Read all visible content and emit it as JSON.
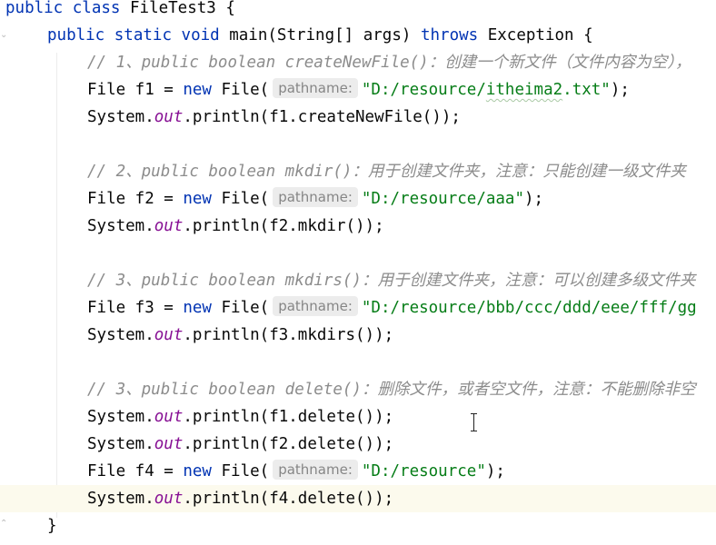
{
  "code": {
    "l0": {
      "kw1": "public",
      "kw2": "class",
      "name": "FileTest3 {"
    },
    "l1": {
      "kw1": "public",
      "kw2": "static",
      "kw3": "void",
      "sig": "main(String[] args)",
      "kw4": "throws",
      "rest": "Exception {"
    },
    "l2": {
      "comment": "// 1、public boolean createNewFile()：创建一个新文件（文件内容为空），"
    },
    "l3": {
      "a": "File f1 = ",
      "kw": "new",
      "b": " File(",
      "hint": "pathname:",
      "str_pre": "\"D:/resource/",
      "str_wavy": "itheima2",
      "str_post": ".txt\"",
      "c": ");"
    },
    "l4": {
      "a": "System.",
      "field": "out",
      "b": ".println(f1.createNewFile());"
    },
    "l6": {
      "comment": "// 2、public boolean mkdir()：用于创建文件夹，注意：只能创建一级文件夹"
    },
    "l7": {
      "a": "File f2 = ",
      "kw": "new",
      "b": " File(",
      "hint": "pathname:",
      "str": "\"D:/resource/aaa\"",
      "c": ");"
    },
    "l8": {
      "a": "System.",
      "field": "out",
      "b": ".println(f2.mkdir());"
    },
    "l10": {
      "comment": "// 3、public boolean mkdirs()：用于创建文件夹，注意：可以创建多级文件夹"
    },
    "l11": {
      "a": "File f3 = ",
      "kw": "new",
      "b": " File(",
      "hint": "pathname:",
      "str": "\"D:/resource/bbb/ccc/ddd/eee/fff/gg"
    },
    "l12": {
      "a": "System.",
      "field": "out",
      "b": ".println(f3.mkdirs());"
    },
    "l14": {
      "comment": "// 3、public boolean delete()：删除文件，或者空文件，注意：不能删除非空"
    },
    "l15": {
      "a": "System.",
      "field": "out",
      "b": ".println(f1.delete());"
    },
    "l16": {
      "a": "System.",
      "field": "out",
      "b": ".println(f2.delete());"
    },
    "l17": {
      "a": "File f4 = ",
      "kw": "new",
      "b": " File(",
      "hint": "pathname:",
      "str": "\"D:/resource\"",
      "c": ");"
    },
    "l18": {
      "a": "System.",
      "field": "out",
      "b": ".println(f4.delete());"
    },
    "l19": {
      "text": "}"
    }
  },
  "colors": {
    "keyword": "#0033b3",
    "string": "#067d17",
    "comment": "#8c8c8c",
    "static_field": "#871094",
    "current_line": "#fcfaed",
    "inlay_hint_bg": "#ececec"
  },
  "icons": [
    "fold-marker-icon",
    "text-cursor-icon"
  ]
}
